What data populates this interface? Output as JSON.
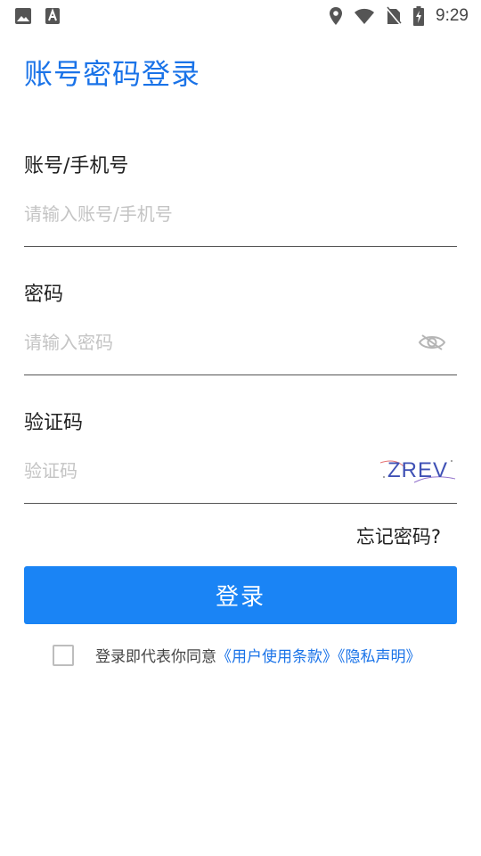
{
  "status_bar": {
    "time": "9:29",
    "icons": [
      "image-icon",
      "text-icon",
      "location-icon",
      "wifi-icon",
      "no-sim-icon",
      "battery-charging-icon"
    ]
  },
  "title": "账号密码登录",
  "account": {
    "label": "账号/手机号",
    "placeholder": "请输入账号/手机号",
    "value": ""
  },
  "password": {
    "label": "密码",
    "placeholder": "请输入密码",
    "value": "",
    "toggle_icon": "eye-icon"
  },
  "captcha": {
    "label": "验证码",
    "placeholder": "验证码",
    "value": "",
    "image_text": "ZREV"
  },
  "forgot_password": "忘记密码?",
  "login_button": "登录",
  "agreement": {
    "checked": false,
    "prefix": "登录即代表你同意",
    "terms_link": "《用户使用条款》",
    "privacy_link": "《隐私声明》"
  },
  "colors": {
    "accent": "#1a73e8",
    "button": "#1a84f5"
  }
}
